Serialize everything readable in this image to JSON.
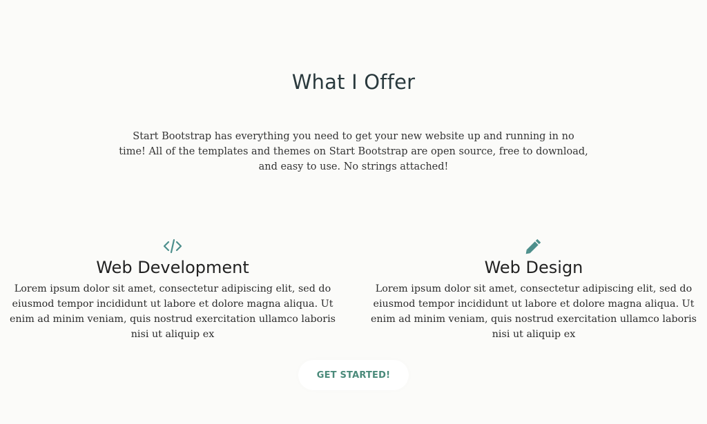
{
  "section": {
    "heading": "What I Offer",
    "lead": "Start Bootstrap has everything you need to get your new website up and running in no time! All of the templates and themes on Start Bootstrap are open source, free to download, and easy to use. No strings attached!"
  },
  "services": [
    {
      "icon": "code-icon",
      "title": "Web Development",
      "text": "Lorem ipsum dolor sit amet, consectetur adipiscing elit, sed do eiusmod tempor incididunt ut labore et dolore magna aliqua. Ut enim ad minim veniam, quis nostrud exercitation ullamco laboris nisi ut aliquip ex"
    },
    {
      "icon": "pencil-icon",
      "title": "Web Design",
      "text": "Lorem ipsum dolor sit amet, consectetur adipiscing elit, sed do eiusmod tempor incididunt ut labore et dolore magna aliqua. Ut enim ad minim veniam, quis nostrud exercitation ullamco laboris nisi ut aliquip ex"
    }
  ],
  "cta": {
    "label": "GET STARTED!"
  },
  "colors": {
    "accent": "#4d8f8c",
    "background": "#fbfbf9"
  }
}
